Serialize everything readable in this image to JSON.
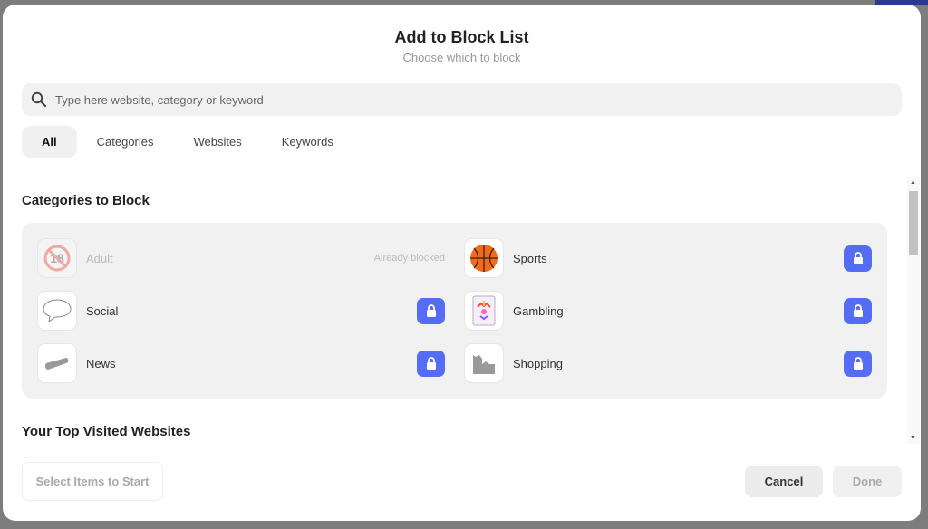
{
  "header": {
    "title": "Add to Block List",
    "subtitle": "Choose which to block"
  },
  "search": {
    "placeholder": "Type here website, category or keyword",
    "value": ""
  },
  "tabs": [
    {
      "label": "All",
      "active": true
    },
    {
      "label": "Categories"
    },
    {
      "label": "Websites"
    },
    {
      "label": "Keywords"
    }
  ],
  "sections": {
    "categories_title": "Categories to Block",
    "top_sites_title": "Your Top Visited Websites"
  },
  "categories": [
    {
      "label": "Adult",
      "icon": "no-18-icon",
      "status": "Already blocked"
    },
    {
      "label": "Sports",
      "icon": "basketball-icon"
    },
    {
      "label": "Social",
      "icon": "speech-bubble-icon"
    },
    {
      "label": "Gambling",
      "icon": "joker-card-icon"
    },
    {
      "label": "News",
      "icon": "megaphone-icon"
    },
    {
      "label": "Shopping",
      "icon": "shopping-bags-icon"
    }
  ],
  "footer": {
    "start_label": "Select Items to Start",
    "cancel_label": "Cancel",
    "done_label": "Done"
  },
  "colors": {
    "accent": "#556cf5",
    "panel": "#f1f1f1",
    "overlay": "#7d7d7d"
  }
}
